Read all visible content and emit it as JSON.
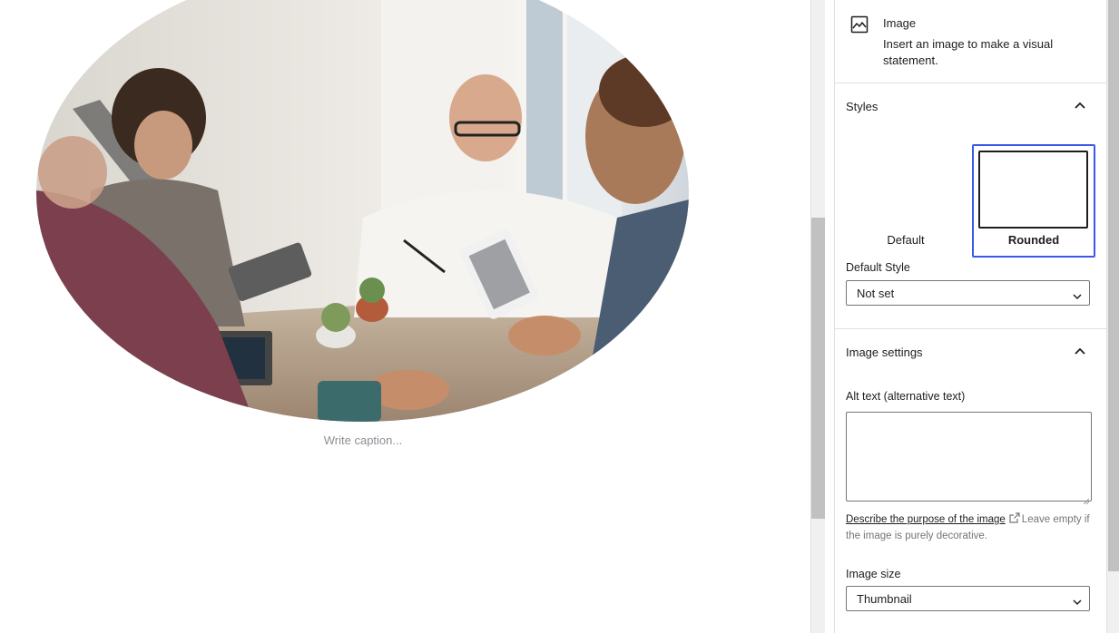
{
  "canvas": {
    "caption_placeholder": "Write caption..."
  },
  "block_card": {
    "icon": "image-icon",
    "title": "Image",
    "description": "Insert an image to make a visual statement."
  },
  "styles_panel": {
    "title": "Styles",
    "toggle_icon": "chevron-up-icon",
    "options": [
      {
        "label": "Default",
        "selected": false
      },
      {
        "label": "Rounded",
        "selected": true
      }
    ],
    "default_style_label": "Default Style",
    "default_style_value": "Not set"
  },
  "image_settings": {
    "title": "Image settings",
    "toggle_icon": "chevron-up-icon",
    "alt_label": "Alt text (alternative text)",
    "alt_value": "",
    "help_link": "Describe the purpose of the image",
    "help_link_icon": "external-link-icon",
    "help_text": "Leave empty if the image is purely decorative.",
    "size_label": "Image size",
    "size_value": "Thumbnail"
  },
  "colors": {
    "accent": "#3858e9",
    "border": "#e0e0e0",
    "text": "#1e1e1e",
    "muted": "#757575"
  }
}
